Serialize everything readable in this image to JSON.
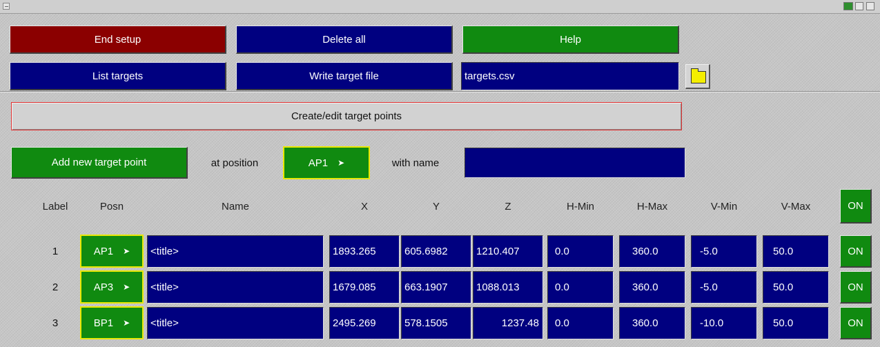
{
  "toolbar": {
    "end_setup": "End setup",
    "delete_all": "Delete all",
    "help": "Help",
    "list_targets": "List targets",
    "write_target_file": "Write target file",
    "filename": "targets.csv"
  },
  "panel": {
    "title": "Create/edit target points",
    "add_button": "Add new target point",
    "at_position_label": "at position",
    "position_value": "AP1",
    "with_name_label": "with name",
    "name_value": ""
  },
  "table": {
    "headers": {
      "label": "Label",
      "posn": "Posn",
      "name": "Name",
      "x": "X",
      "y": "Y",
      "z": "Z",
      "hmin": "H-Min",
      "hmax": "H-Max",
      "vmin": "V-Min",
      "vmax": "V-Max",
      "on": "ON"
    },
    "rows": [
      {
        "label": "1",
        "posn": "AP1",
        "name": "<title>",
        "x": "1893.265",
        "y": "605.6982",
        "z": "1210.407",
        "hmin": "0.0",
        "hmax": "360.0",
        "vmin": "-5.0",
        "vmax": "50.0",
        "on": "ON"
      },
      {
        "label": "2",
        "posn": "AP3",
        "name": "<title>",
        "x": "1679.085",
        "y": "663.1907",
        "z": "1088.013",
        "hmin": "0.0",
        "hmax": "360.0",
        "vmin": "-5.0",
        "vmax": "50.0",
        "on": "ON"
      },
      {
        "label": "3",
        "posn": "BP1",
        "name": "<title>",
        "x": "2495.269",
        "y": "578.1505",
        "z": "1237.48",
        "hmin": "0.0",
        "hmax": "360.0",
        "vmin": "-10.0",
        "vmax": "50.0",
        "on": "ON"
      }
    ]
  },
  "icons": {
    "folder": "folder-icon",
    "dropdown": "arrow-right-icon"
  },
  "colors": {
    "red_button": "#8b0000",
    "blue_button": "#000080",
    "green_button": "#108a10",
    "highlight_border": "#e8e800",
    "panel_border": "#e03030"
  }
}
